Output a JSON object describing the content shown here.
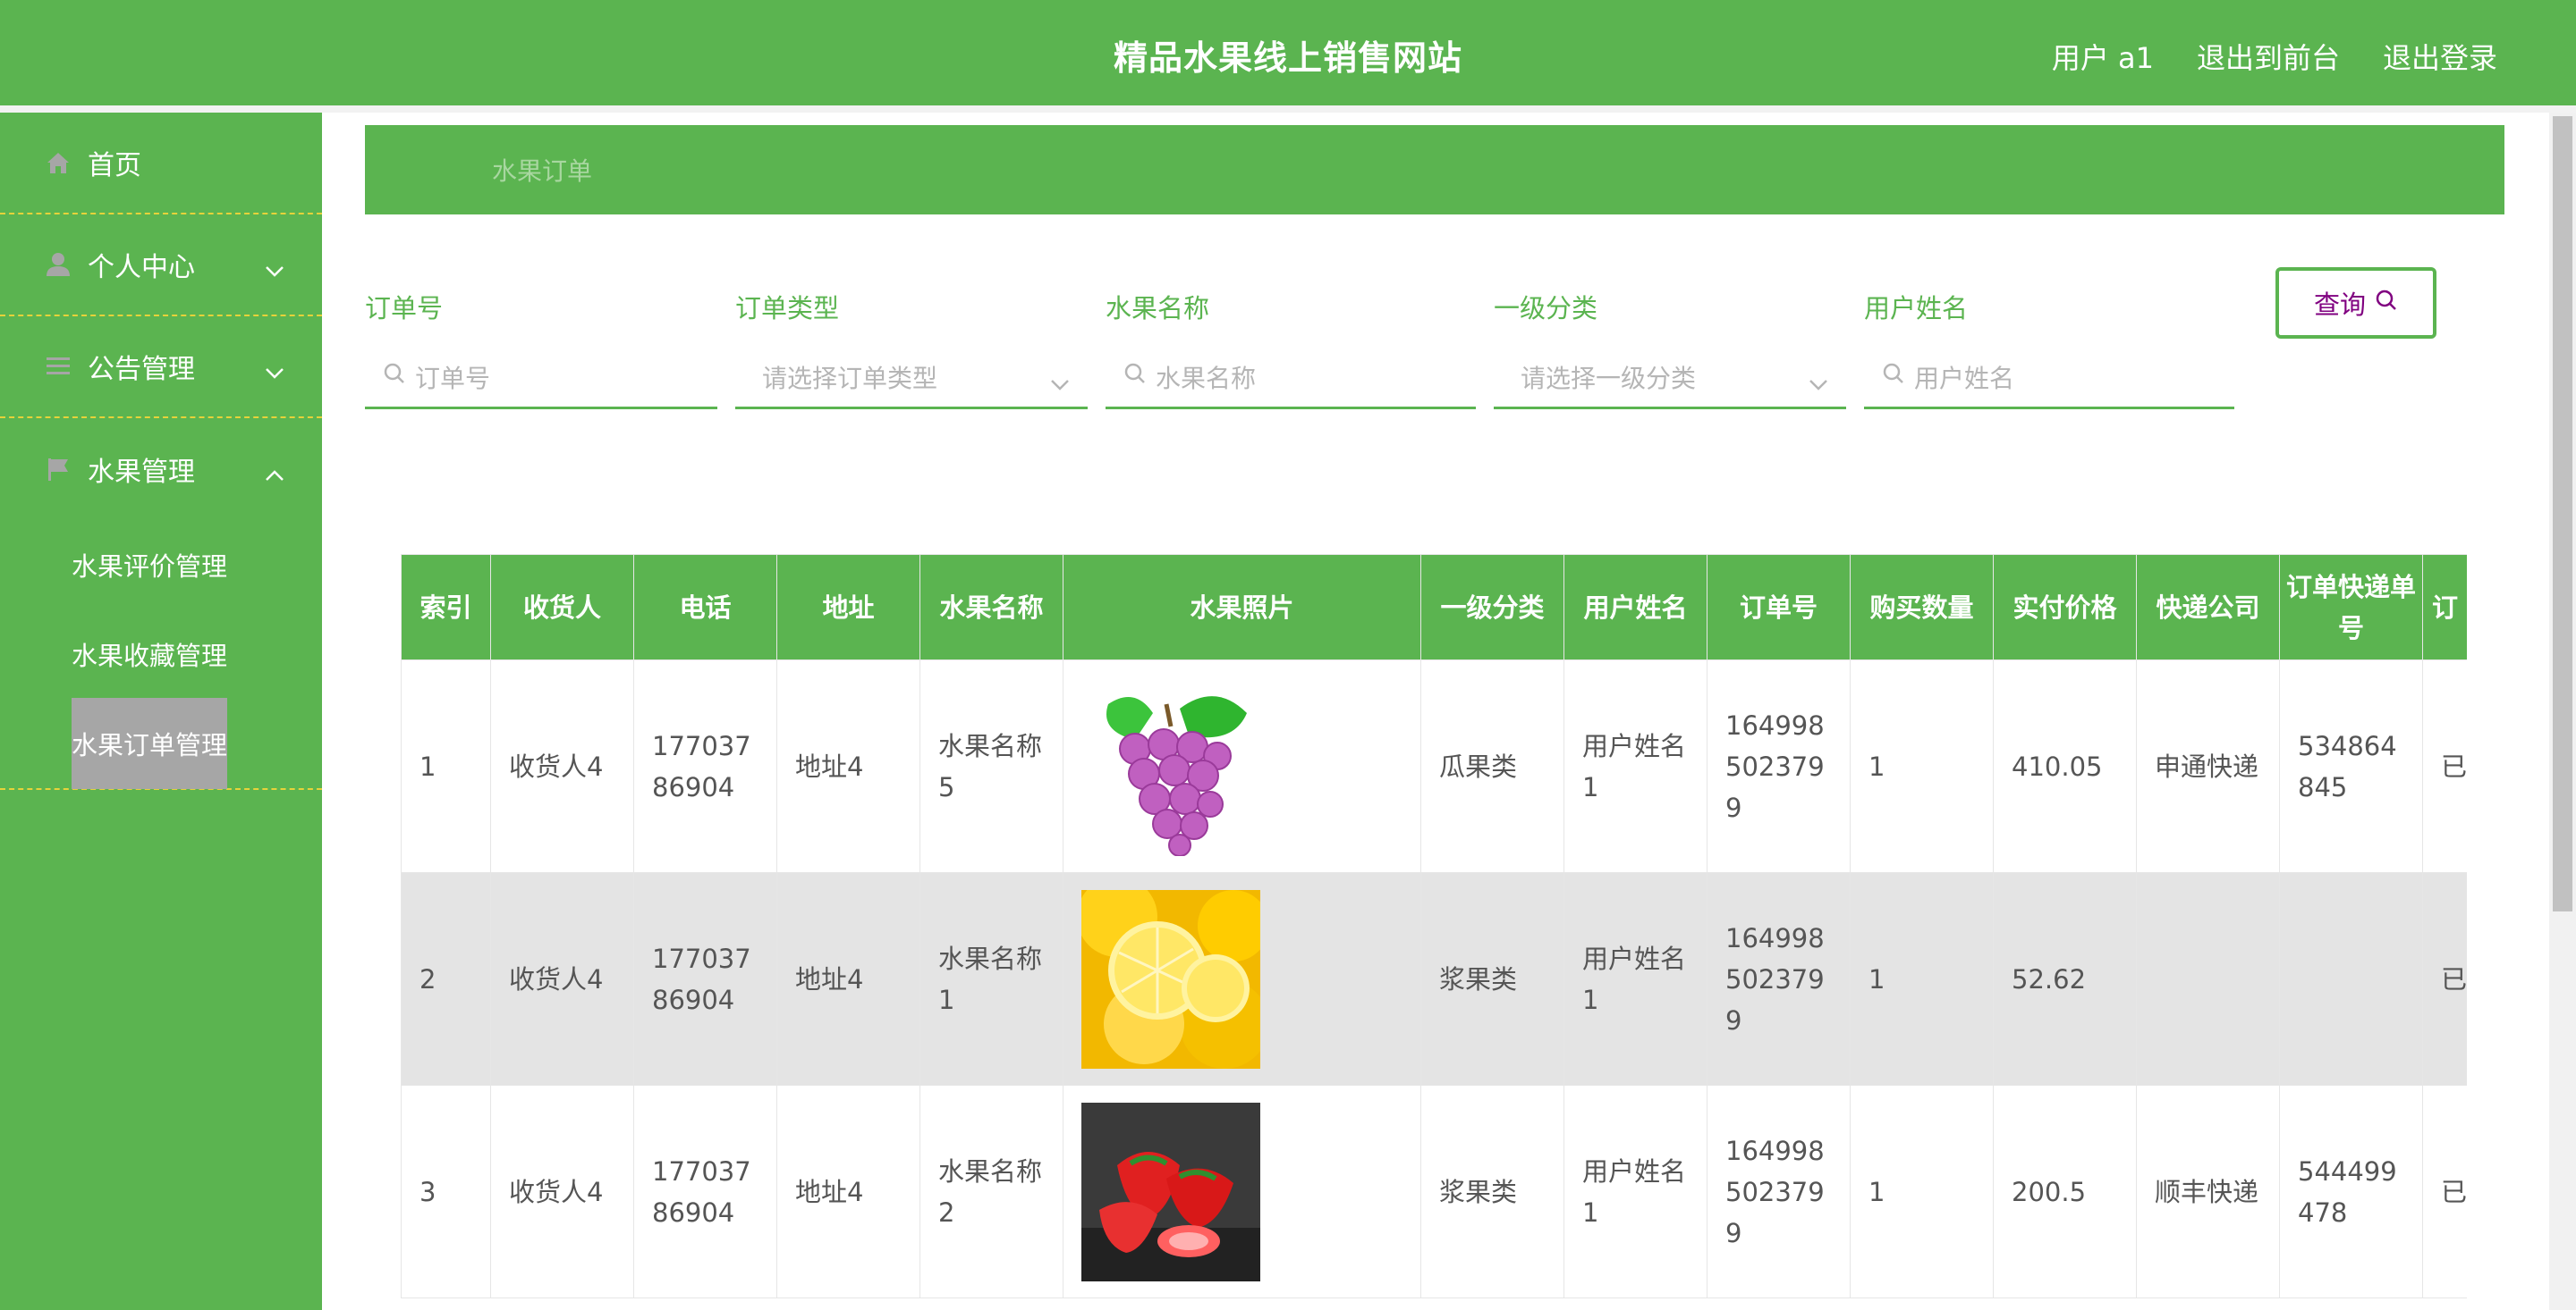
{
  "header": {
    "title": "精品水果线上销售网站",
    "user_label": "用户 a1",
    "back_to_front": "退出到前台",
    "logout": "退出登录"
  },
  "sidebar": {
    "items": [
      {
        "label": "首页",
        "icon": "home-icon"
      },
      {
        "label": "个人中心",
        "icon": "user-icon"
      },
      {
        "label": "公告管理",
        "icon": "list-icon"
      },
      {
        "label": "水果管理",
        "icon": "flag-icon"
      }
    ],
    "submenu": [
      {
        "label": "水果评价管理"
      },
      {
        "label": "水果收藏管理"
      },
      {
        "label": "水果订单管理"
      }
    ]
  },
  "breadcrumb": "水果订单",
  "search": {
    "fields": [
      {
        "label": "订单号",
        "placeholder": "订单号"
      },
      {
        "label": "订单类型",
        "placeholder": "请选择订单类型"
      },
      {
        "label": "水果名称",
        "placeholder": "水果名称"
      },
      {
        "label": "一级分类",
        "placeholder": "请选择一级分类"
      },
      {
        "label": "用户姓名",
        "placeholder": "用户姓名"
      }
    ],
    "query_label": "查询"
  },
  "table": {
    "headers": [
      "索引",
      "收货人",
      "电话",
      "地址",
      "水果名称",
      "水果照片",
      "一级分类",
      "用户姓名",
      "订单号",
      "购买数量",
      "实付价格",
      "快递公司",
      "订单快递单号",
      "订"
    ],
    "rows": [
      {
        "index": "1",
        "receiver": "收货人4",
        "phone": "17703786904",
        "address": "地址4",
        "fruit": "水果名称5",
        "photo": "grapes",
        "category": "瓜果类",
        "username": "用户姓名1",
        "order_no": "1649985023799",
        "qty": "1",
        "price": "410.05",
        "courier": "申通快递",
        "tracking": "534864845",
        "status": "已"
      },
      {
        "index": "2",
        "receiver": "收货人4",
        "phone": "17703786904",
        "address": "地址4",
        "fruit": "水果名称1",
        "photo": "lemons",
        "category": "浆果类",
        "username": "用户姓名1",
        "order_no": "1649985023799",
        "qty": "1",
        "price": "52.62",
        "courier": "",
        "tracking": "",
        "status": "已"
      },
      {
        "index": "3",
        "receiver": "收货人4",
        "phone": "17703786904",
        "address": "地址4",
        "fruit": "水果名称2",
        "photo": "strawberries",
        "category": "浆果类",
        "username": "用户姓名1",
        "order_no": "1649985023799",
        "qty": "1",
        "price": "200.5",
        "courier": "顺丰快递",
        "tracking": "544499478",
        "status": "已"
      }
    ]
  },
  "colors": {
    "primary": "#5bb450",
    "query_text": "#800080",
    "divider": "#e6d23a"
  }
}
